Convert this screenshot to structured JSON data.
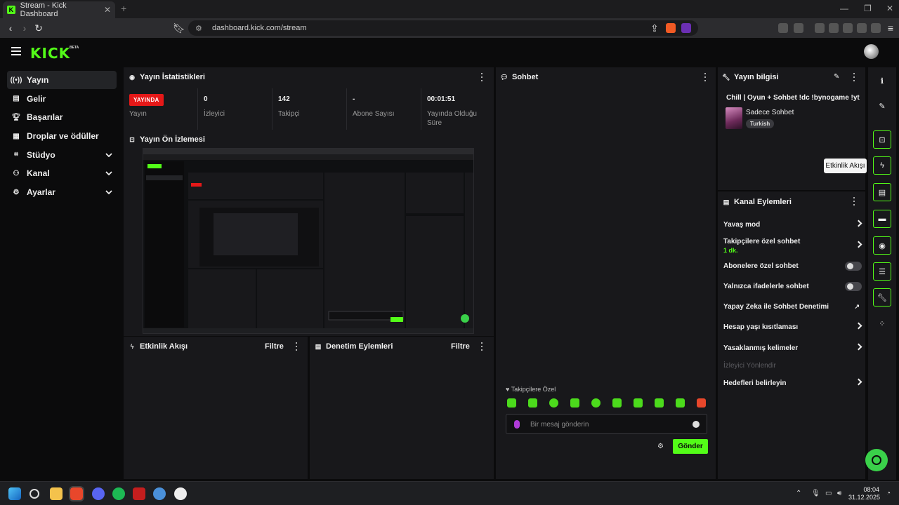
{
  "browser": {
    "tab_title": "Stream - Kick Dashboard",
    "url": "dashboard.kick.com/stream"
  },
  "app": {
    "logo": "KICK",
    "logo_badge": "BETA"
  },
  "nav": {
    "items": [
      {
        "label": "Yayın",
        "icon": "broadcast-icon"
      },
      {
        "label": "Gelir",
        "icon": "revenue-icon"
      },
      {
        "label": "Başarılar",
        "icon": "trophy-icon"
      },
      {
        "label": "Droplar ve ödüller",
        "icon": "gift-icon"
      },
      {
        "label": "Stüdyo",
        "icon": "studio-icon"
      },
      {
        "label": "Kanal",
        "icon": "channel-icon"
      },
      {
        "label": "Ayarlar",
        "icon": "gear-icon"
      }
    ]
  },
  "stats": {
    "title": "Yayın İstatistikleri",
    "live_badge": "YAYINDA",
    "cells": [
      {
        "value": "",
        "label": "Yayın"
      },
      {
        "value": "0",
        "label": "İzleyici"
      },
      {
        "value": "142",
        "label": "Takipçi"
      },
      {
        "value": "-",
        "label": "Abone Sayısı"
      },
      {
        "value": "00:01:51",
        "label": "Yayında Olduğu Süre"
      }
    ]
  },
  "preview": {
    "title": "Yayın Ön İzlemesi"
  },
  "activity": {
    "title": "Etkinlik Akışı",
    "filter": "Filtre"
  },
  "moderation": {
    "title": "Denetim Eylemleri",
    "filter": "Filtre"
  },
  "chat": {
    "title": "Sohbet",
    "mode_label": "Takipçilere Özel",
    "placeholder": "Bir mesaj gönderin",
    "send_label": "Gönder"
  },
  "stream_info": {
    "title": "Yayın bilgisi",
    "stream_title": "Chill | Oyun + Sohbet !dc !bynogame !yt",
    "category": "Sadece Sohbet",
    "language": "Turkish"
  },
  "channel_actions": {
    "title": "Kanal Eylemleri",
    "items": [
      {
        "label": "Yavaş mod",
        "type": "link"
      },
      {
        "label": "Takipçilere özel sohbet",
        "sub": "1 dk.",
        "type": "link"
      },
      {
        "label": "Abonelere özel sohbet",
        "type": "toggle",
        "on": false
      },
      {
        "label": "Yalnızca ifadelerle sohbet",
        "type": "toggle",
        "on": false
      },
      {
        "label": "Yapay Zeka ile Sohbet Denetimi",
        "type": "external"
      },
      {
        "label": "Hesap yaşı kısıtlaması",
        "type": "link"
      },
      {
        "label": "Yasaklanmış kelimeler",
        "type": "link"
      },
      {
        "label": "İzleyici Yönlendir",
        "type": "disabled"
      },
      {
        "label": "Hedefleri belirleyin",
        "type": "link"
      }
    ]
  },
  "rail": {
    "tooltip": "Etkinlik Akışı"
  },
  "taskbar": {
    "time": "08:04",
    "date": "31.12.2025"
  },
  "colors": {
    "accent": "#53fc18",
    "live": "#e51818",
    "panel": "#18181b",
    "background": "#0b0b0c"
  }
}
